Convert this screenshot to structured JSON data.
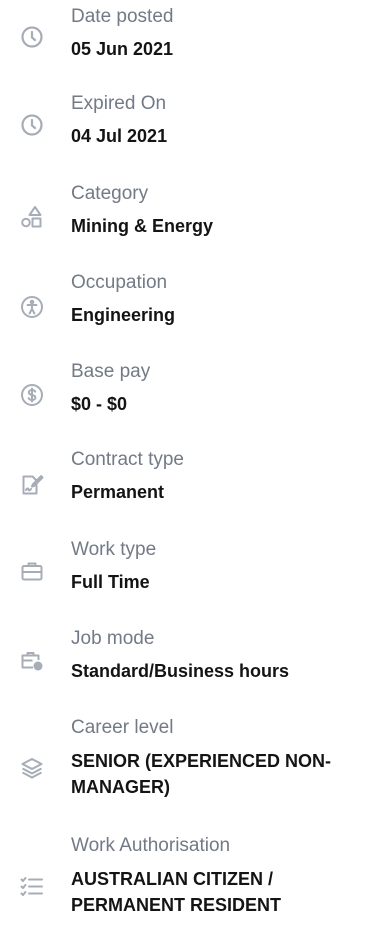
{
  "details": [
    {
      "icon": "clock-icon",
      "label": "Date posted",
      "value": "05 Jun 2021"
    },
    {
      "icon": "clock-icon",
      "label": "Expired On",
      "value": "04 Jul 2021"
    },
    {
      "icon": "category-shapes-icon",
      "label": "Category",
      "value": "Mining & Energy"
    },
    {
      "icon": "accessibility-person-icon",
      "label": "Occupation",
      "value": "Engineering"
    },
    {
      "icon": "dollar-coin-icon",
      "label": "Base pay",
      "value": "$0 - $0"
    },
    {
      "icon": "contract-signature-icon",
      "label": "Contract type",
      "value": "Permanent"
    },
    {
      "icon": "briefcase-icon",
      "label": "Work type",
      "value": "Full Time"
    },
    {
      "icon": "briefcase-clock-icon",
      "label": "Job mode",
      "value": "Standard/Business hours"
    },
    {
      "icon": "layers-icon",
      "label": "Career level",
      "value": "SENIOR (EXPERIENCED NON-MANAGER)"
    },
    {
      "icon": "checklist-icon",
      "label": "Work Authorisation",
      "value": "AUSTRALIAN CITIZEN / PERMANENT RESIDENT"
    }
  ],
  "colors": {
    "icon": "#a7adb6",
    "label": "#727a86",
    "value": "#141414",
    "background": "#ffffff"
  }
}
